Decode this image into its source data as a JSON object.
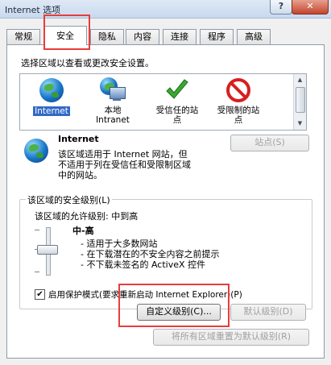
{
  "window": {
    "title": "Internet 选项",
    "help_label": "?",
    "close_label": "✕"
  },
  "tabs": [
    {
      "label": "常规"
    },
    {
      "label": "安全"
    },
    {
      "label": "隐私"
    },
    {
      "label": "内容"
    },
    {
      "label": "连接"
    },
    {
      "label": "程序"
    },
    {
      "label": "高级"
    }
  ],
  "active_tab": "安全",
  "security": {
    "zone_prompt": "选择区域以查看或更改安全设置。",
    "zones": [
      {
        "label": "Internet",
        "icon": "globe-icon",
        "selected": true
      },
      {
        "label": "本地\nIntranet",
        "icon": "intranet-icon",
        "selected": false
      },
      {
        "label": "受信任的站\n点",
        "icon": "check-icon",
        "selected": false
      },
      {
        "label": "受限制的站\n点",
        "icon": "restricted-icon",
        "selected": false
      }
    ],
    "zone_title": "Internet",
    "zone_desc_1": "该区域适用于 Internet 网站，但",
    "zone_desc_2": "不适用于列在受信任和受限制区域",
    "zone_desc_3": "中的网站。",
    "sites_button": "站点(S)",
    "level_group": "该区域的安全级别(L)",
    "allowed_levels": "该区域的允许级别: 中到高",
    "level_name": "中-高",
    "level_items": [
      "- 适用于大多数网站",
      "- 在下载潜在的不安全内容之前提示",
      "- 不下载未签名的 ActiveX 控件"
    ],
    "protected_mode": "启用保护模式(要求重新启动 Internet Explorer)(P)",
    "protected_mode_checked": true,
    "custom_level_button": "自定义级别(C)...",
    "default_level_button": "默认级别(D)",
    "reset_all_button": "将所有区域重置为默认级别(R)"
  },
  "colors": {
    "highlight": "#e83c3c",
    "selection": "#3169c6"
  }
}
